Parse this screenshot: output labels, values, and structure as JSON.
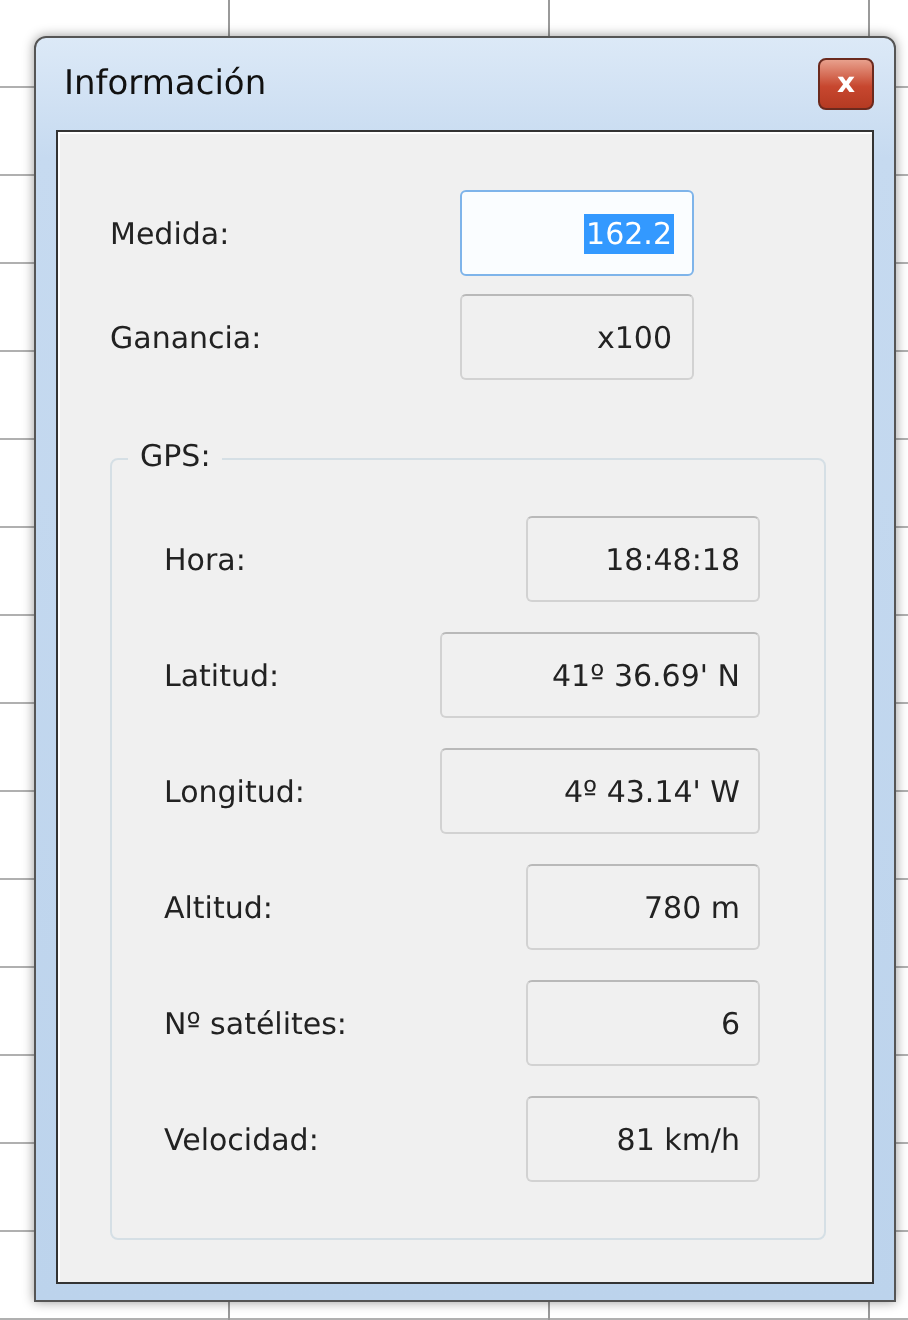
{
  "window": {
    "title": "Información",
    "close": "x"
  },
  "fields": [
    {
      "label": "Medida:",
      "value": "162.2",
      "focused": true,
      "selected": true
    },
    {
      "label": "Ganancia:",
      "value": "x100",
      "focused": false,
      "selected": false
    }
  ],
  "gps": {
    "title": "GPS:",
    "rows": [
      {
        "label": "Hora:",
        "value": "18:48:18",
        "kind": "short"
      },
      {
        "label": "Latitud:",
        "value": "41º 36.69' N",
        "kind": "long"
      },
      {
        "label": "Longitud:",
        "value": "4º 43.14' W",
        "kind": "long"
      },
      {
        "label": "Altitud:",
        "value": "780 m",
        "kind": "short"
      },
      {
        "label": "Nº satélites:",
        "value": "6",
        "kind": "short"
      },
      {
        "label": "Velocidad:",
        "value": "81 km/h",
        "kind": "short"
      }
    ]
  }
}
